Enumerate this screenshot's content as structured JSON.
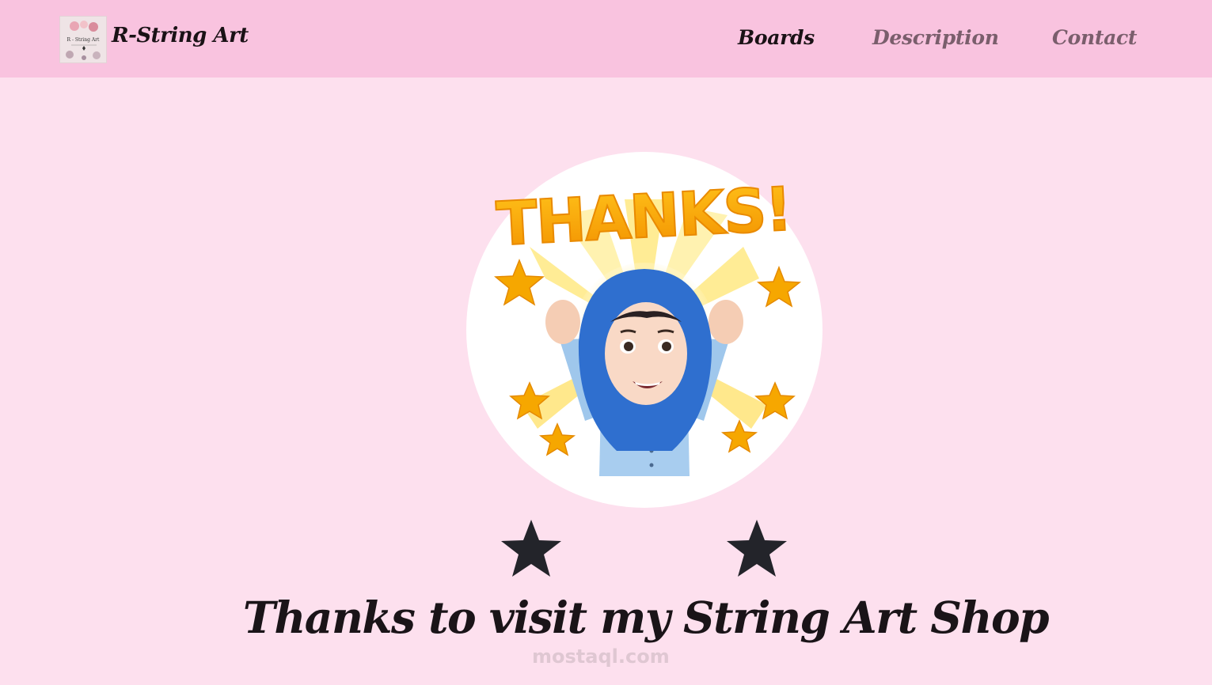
{
  "header": {
    "brand": "R-String Art",
    "logo_text": "R - String Art",
    "nav": [
      {
        "label": "Boards",
        "active": true
      },
      {
        "label": "Description",
        "active": false
      },
      {
        "label": "Contact",
        "active": false
      }
    ]
  },
  "hero": {
    "sticker_text": "THANKS!"
  },
  "main": {
    "headline": "Thanks to visit my String Art Shop"
  },
  "watermark": "mostaql.com",
  "colors": {
    "nav_bg": "#f9c3df",
    "page_bg": "#fde0ee",
    "active_link": "#1a1216",
    "inactive_link": "#7a5e6c",
    "sticker_gold": "#f6a700",
    "hijab_blue": "#2f6fcf"
  },
  "icons": [
    "star-icon"
  ]
}
